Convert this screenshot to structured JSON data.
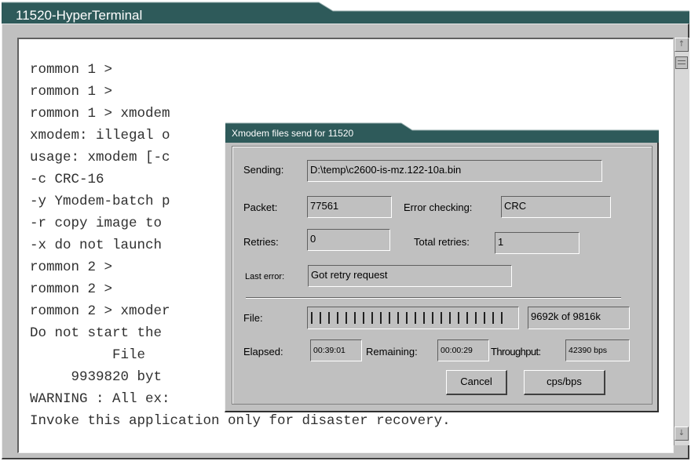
{
  "window": {
    "title": "11520-HyperTerminal"
  },
  "terminal": {
    "lines": [
      "rommon 1 >",
      "rommon 1 >",
      "rommon 1 > xmodem",
      "xmodem: illegal o",
      "usage: xmodem [-c",
      "-c CRC-16",
      "-y Ymodem-batch p",
      "-r copy image to",
      "-x do not launch",
      "rommon 2 >",
      "rommon 2 >",
      "rommon 2 > xmoder",
      "Do not start the",
      "          File",
      "     9939820 byt",
      "WARNING : All ex:",
      "Invoke this application only for disaster recovery."
    ]
  },
  "scrollbar": {
    "up_icon": "arrow-up-icon",
    "down_icon": "arrow-down-icon"
  },
  "dialog": {
    "title": "Xmodem files send for 11520",
    "sending_label": "Sending:",
    "sending_value": "D:\\temp\\c2600-is-mz.122-10a.bin",
    "packet_label": "Packet:",
    "packet_value": "77561",
    "error_checking_label": "Error checking:",
    "error_checking_value": "CRC",
    "retries_label": "Retries:",
    "retries_value": "0",
    "total_retries_label": "Total retries:",
    "total_retries_value": "1",
    "last_error_label": "Last error:",
    "last_error_value": "Got retry request",
    "file_label": "File:",
    "file_progress": 0.987,
    "file_size_value": "9692k of 9816k",
    "elapsed_label": "Elapsed:",
    "elapsed_value": "00:39:01",
    "remaining_label": "Remaining:",
    "remaining_value": "00:00:29",
    "throughput_label": "Throughput:",
    "throughput_value": "42390 bps",
    "cancel_label": "Cancel",
    "cps_label": "cps/bps"
  },
  "colors": {
    "titlebar": "#2e5a5a",
    "window_face": "#c0c0c0"
  }
}
